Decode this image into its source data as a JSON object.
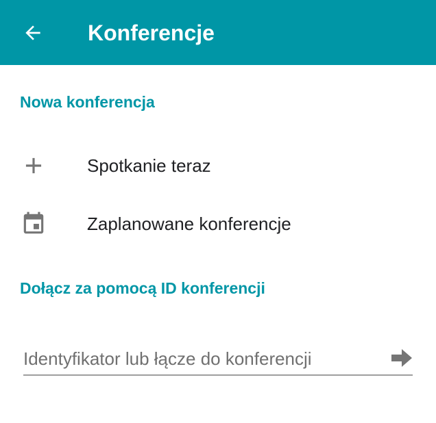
{
  "appbar": {
    "title": "Konferencje",
    "back_icon": "arrow-back-icon",
    "background_color": "#0096a6"
  },
  "sections": {
    "new_conference": {
      "header": "Nowa konferencja",
      "items": [
        {
          "label": "Spotkanie teraz",
          "icon": "plus-icon"
        },
        {
          "label": "Zaplanowane konferencje",
          "icon": "calendar-icon"
        }
      ]
    },
    "join": {
      "header": "Dołącz za pomocą ID konferencji",
      "input": {
        "value": "",
        "placeholder": "Identyfikator lub łącze do konferencji"
      },
      "submit_icon": "arrow-forward-icon"
    }
  },
  "colors": {
    "accent": "#0096a6",
    "text_primary": "#202124",
    "icon_gray": "#757575",
    "hint_gray": "#707070"
  }
}
